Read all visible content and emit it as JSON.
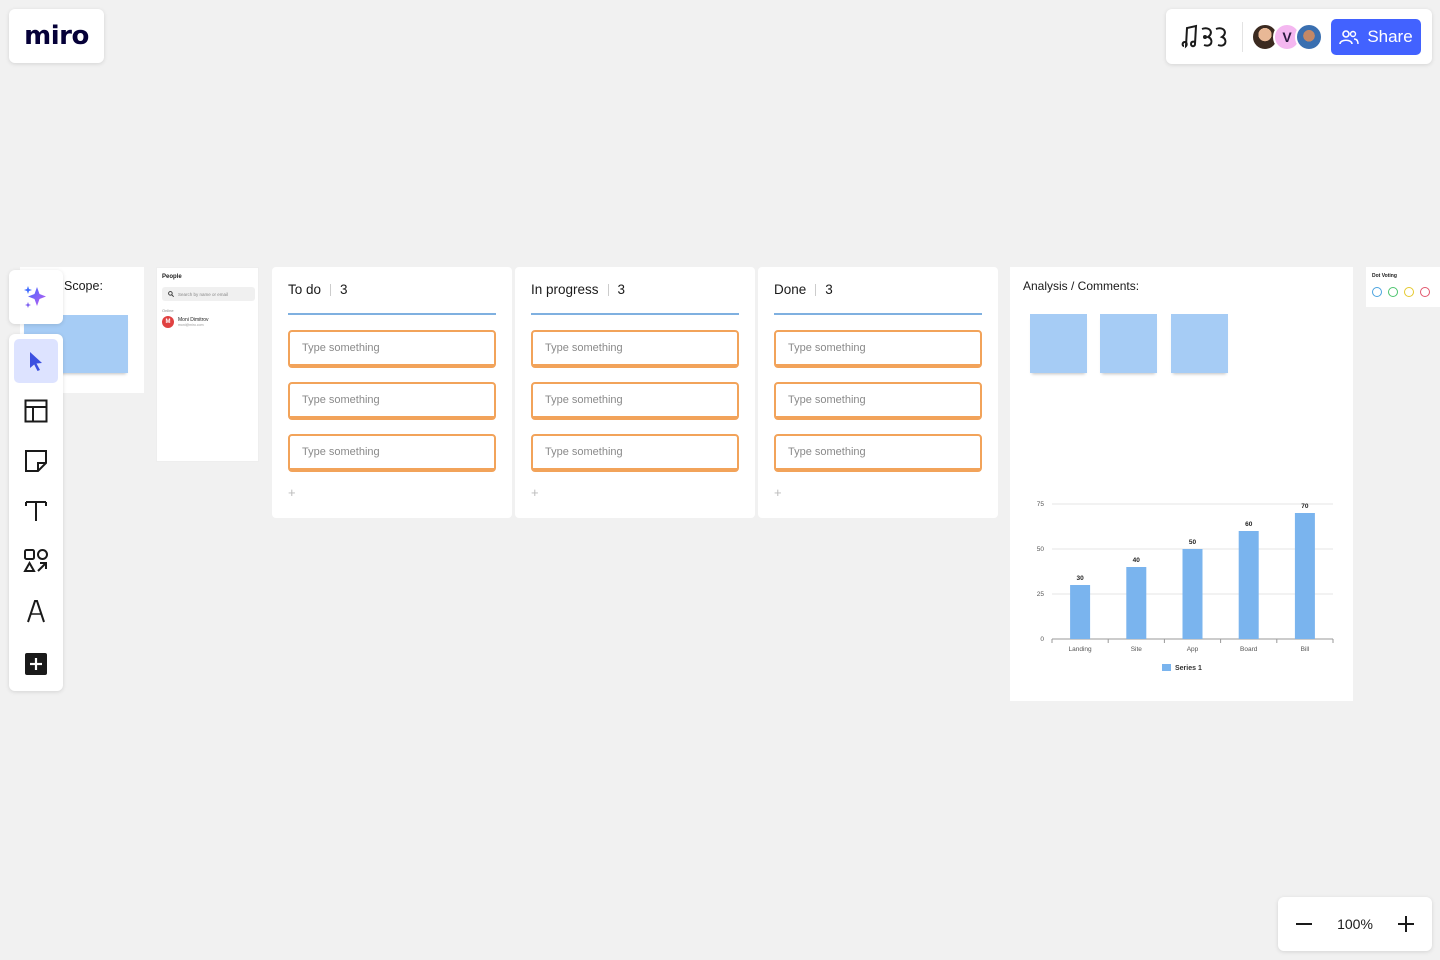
{
  "app": {
    "logo_text": "miro"
  },
  "header": {
    "collaborators": [
      {
        "name": "avatar-1",
        "initial": ""
      },
      {
        "name": "avatar-2",
        "initial": "V"
      },
      {
        "name": "avatar-3",
        "initial": ""
      }
    ],
    "share_label": "Share"
  },
  "toolbar": {
    "tools": [
      "ai-sparkle-icon",
      "select-cursor-icon",
      "templates-icon",
      "sticky-note-icon",
      "text-icon",
      "shapes-icon",
      "pen-icon",
      "add-more-icon"
    ],
    "active_tool": "select"
  },
  "board": {
    "scope": {
      "title": "Scope:"
    },
    "people": {
      "title": "People",
      "search_placeholder": "Search by name or email",
      "online_label": "Online",
      "member_name": "Moni Dimitrov",
      "member_email": "moni@miro.com",
      "member_initial": "M"
    },
    "kanban": [
      {
        "title": "To do",
        "count": "3",
        "cards": [
          "Type something",
          "Type something",
          "Type something"
        ],
        "add": "+"
      },
      {
        "title": "In progress",
        "count": "3",
        "cards": [
          "Type something",
          "Type something",
          "Type something"
        ],
        "add": "+"
      },
      {
        "title": "Done",
        "count": "3",
        "cards": [
          "Type something",
          "Type something",
          "Type something"
        ],
        "add": "+"
      }
    ],
    "analysis": {
      "title": "Analysis / Comments:"
    },
    "dot_voting": {
      "title": "Dot Voting",
      "colors": [
        "#4aa3df",
        "#4cc46e",
        "#e5c92e",
        "#e2566d"
      ]
    }
  },
  "chart_data": {
    "type": "bar",
    "categories": [
      "Landing",
      "Site",
      "App",
      "Board",
      "Bill"
    ],
    "series": [
      {
        "name": "Series 1",
        "values": [
          30,
          40,
          50,
          60,
          70
        ],
        "color": "#7ab4ee"
      }
    ],
    "yticks": [
      "0",
      "25",
      "50",
      "75"
    ],
    "ylim": [
      0,
      75
    ],
    "grid": true,
    "legend": "bottom"
  },
  "zoom": {
    "level": "100%"
  },
  "colors": {
    "accent": "#4262ff",
    "card_border": "#f2a35a",
    "sticky": "#a6ccf5",
    "column_line": "#7fb0e0"
  }
}
